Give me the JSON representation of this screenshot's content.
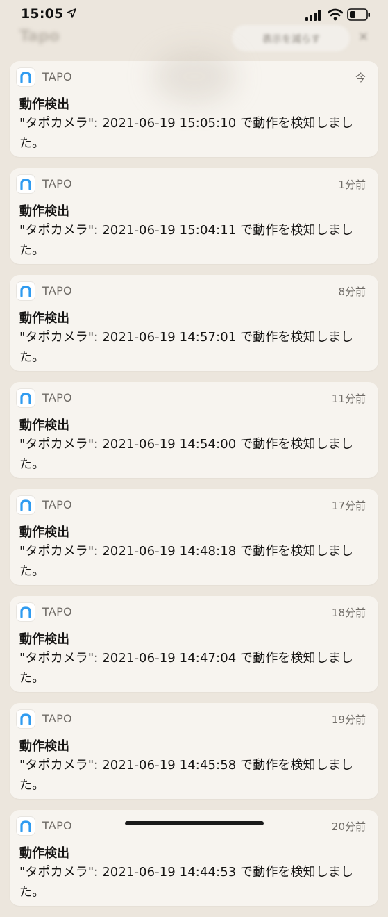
{
  "status_bar": {
    "time": "15:05"
  },
  "header": {
    "title": "Tapo",
    "pill_label": "表示を減らす",
    "close": "×"
  },
  "notifications": [
    {
      "app": "TAPO",
      "time": "今",
      "title": "動作検出",
      "body": "\"タポカメラ\": 2021-06-19 15:05:10 で動作を検知しました。"
    },
    {
      "app": "TAPO",
      "time": "1分前",
      "title": "動作検出",
      "body": "\"タポカメラ\": 2021-06-19 15:04:11 で動作を検知しました。"
    },
    {
      "app": "TAPO",
      "time": "8分前",
      "title": "動作検出",
      "body": "\"タポカメラ\": 2021-06-19 14:57:01 で動作を検知しました。"
    },
    {
      "app": "TAPO",
      "time": "11分前",
      "title": "動作検出",
      "body": "\"タポカメラ\": 2021-06-19 14:54:00 で動作を検知しました。"
    },
    {
      "app": "TAPO",
      "time": "17分前",
      "title": "動作検出",
      "body": "\"タポカメラ\": 2021-06-19 14:48:18 で動作を検知しました。"
    },
    {
      "app": "TAPO",
      "time": "18分前",
      "title": "動作検出",
      "body": "\"タポカメラ\": 2021-06-19 14:47:04 で動作を検知しました。"
    },
    {
      "app": "TAPO",
      "time": "19分前",
      "title": "動作検出",
      "body": "\"タポカメラ\": 2021-06-19 14:45:58 で動作を検知しました。"
    },
    {
      "app": "TAPO",
      "time": "20分前",
      "title": "動作検出",
      "body": "\"タポカメラ\": 2021-06-19 14:44:53 で動作を検知しました。"
    }
  ],
  "icons": {
    "app": "tapo-app-icon",
    "location": "location-arrow-icon",
    "signal": "cellular-signal-icon",
    "wifi": "wifi-icon",
    "battery": "battery-icon"
  },
  "colors": {
    "background": "#ece6dd",
    "card": "#f7f4ef",
    "app_icon_blue": "#2f9bf0"
  }
}
